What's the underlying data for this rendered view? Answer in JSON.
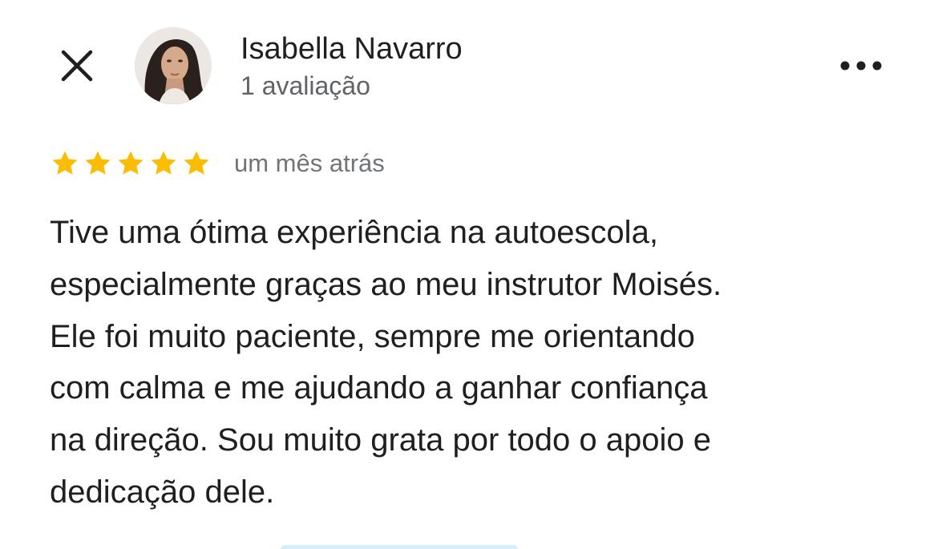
{
  "reviewer": {
    "name": "Isabella Navarro",
    "review_count": "1 avaliação"
  },
  "rating": {
    "stars": 5,
    "max_stars": 5,
    "date": "um mês atrás",
    "star_color": "#fbbc04"
  },
  "review": {
    "text": "Tive uma ótima experiência na autoescola,\nespecialmente graças ao meu instrutor Moisés.\nEle foi muito paciente, sempre me orientando\ncom calma e me ajudando a ganhar confiança\nna direção. Sou muito grata por todo o apoio e\ndedicação dele."
  },
  "icons": {
    "close": "close-icon",
    "more": "more-horizontal-icon",
    "star": "star-icon"
  }
}
